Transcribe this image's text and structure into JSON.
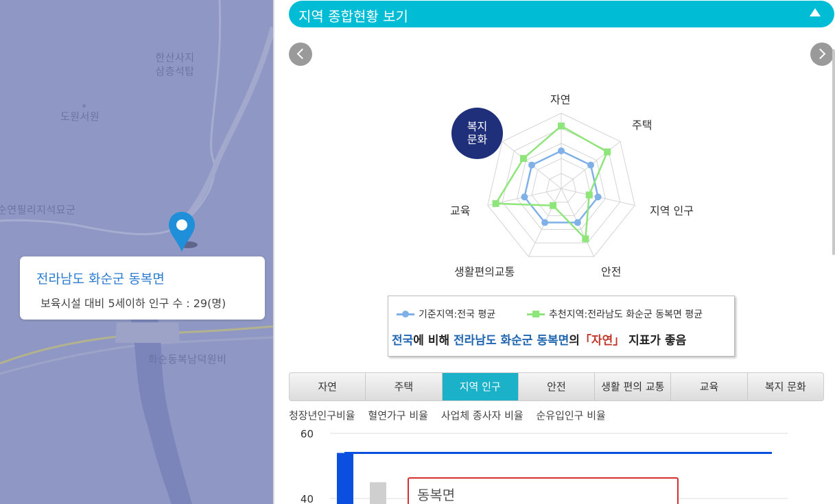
{
  "map": {
    "labels": {
      "temple_top": "한산사지",
      "temple_bottom": "삼층석탑",
      "dowon": "도원서원",
      "pagoda": "순연필리지석묘군",
      "hwasun": "화순동복남덕원비"
    },
    "info": {
      "title": "전라남도 화순군 동복면",
      "subtitle": "보육시설 대비 5세이하 인구 수 : 29(명)"
    }
  },
  "header": {
    "title": "지역 종합현황 보기"
  },
  "radar": {
    "axes": [
      "자연",
      "주택",
      "지역 인구",
      "안전",
      "생활편의교통",
      "교육",
      "복지 문화"
    ],
    "badge_line1": "복지",
    "badge_line2": "문화",
    "series": [
      {
        "name": "기준지역:전국 평균",
        "color": "#7fb0e8",
        "values": [
          0.5,
          0.5,
          0.5,
          0.5,
          0.5,
          0.5,
          0.5
        ]
      },
      {
        "name": "추천지역:전라남도 화순군 동복면 평균",
        "color": "#8ee67a",
        "values": [
          0.83,
          0.78,
          0.38,
          0.74,
          0.25,
          0.89,
          0.64
        ]
      }
    ]
  },
  "legend": {
    "series_a": "기준지역:전국 평균",
    "series_b": "추천지역:전라남도 화순군 동복면 평균",
    "sentence": {
      "part1": "전국",
      "part2": "에 비해 ",
      "part3": "전라남도 화순군 동복면",
      "part4": "의",
      "part5": "「자연」",
      "part6": " 지표가 좋음"
    }
  },
  "tabs": [
    "자연",
    "주택",
    "지역 인구",
    "안전",
    "생활 편의 교통",
    "교육",
    "복지 문화"
  ],
  "active_tab": "지역 인구",
  "subtabs": [
    "청장년인구비율",
    "혈연가구 비율",
    "사업체 종사자 비율",
    "순유입인구 비율"
  ],
  "chart_data": {
    "type": "bar",
    "y_ticks": [
      "60",
      "40"
    ],
    "ylim": [
      40,
      60
    ],
    "line_value": 54,
    "bars": [
      {
        "value": 54,
        "color": "#0b4fe0"
      },
      {
        "value": 45,
        "color": "#cfcfcf"
      }
    ]
  },
  "tooltip": {
    "title": "동복면"
  }
}
